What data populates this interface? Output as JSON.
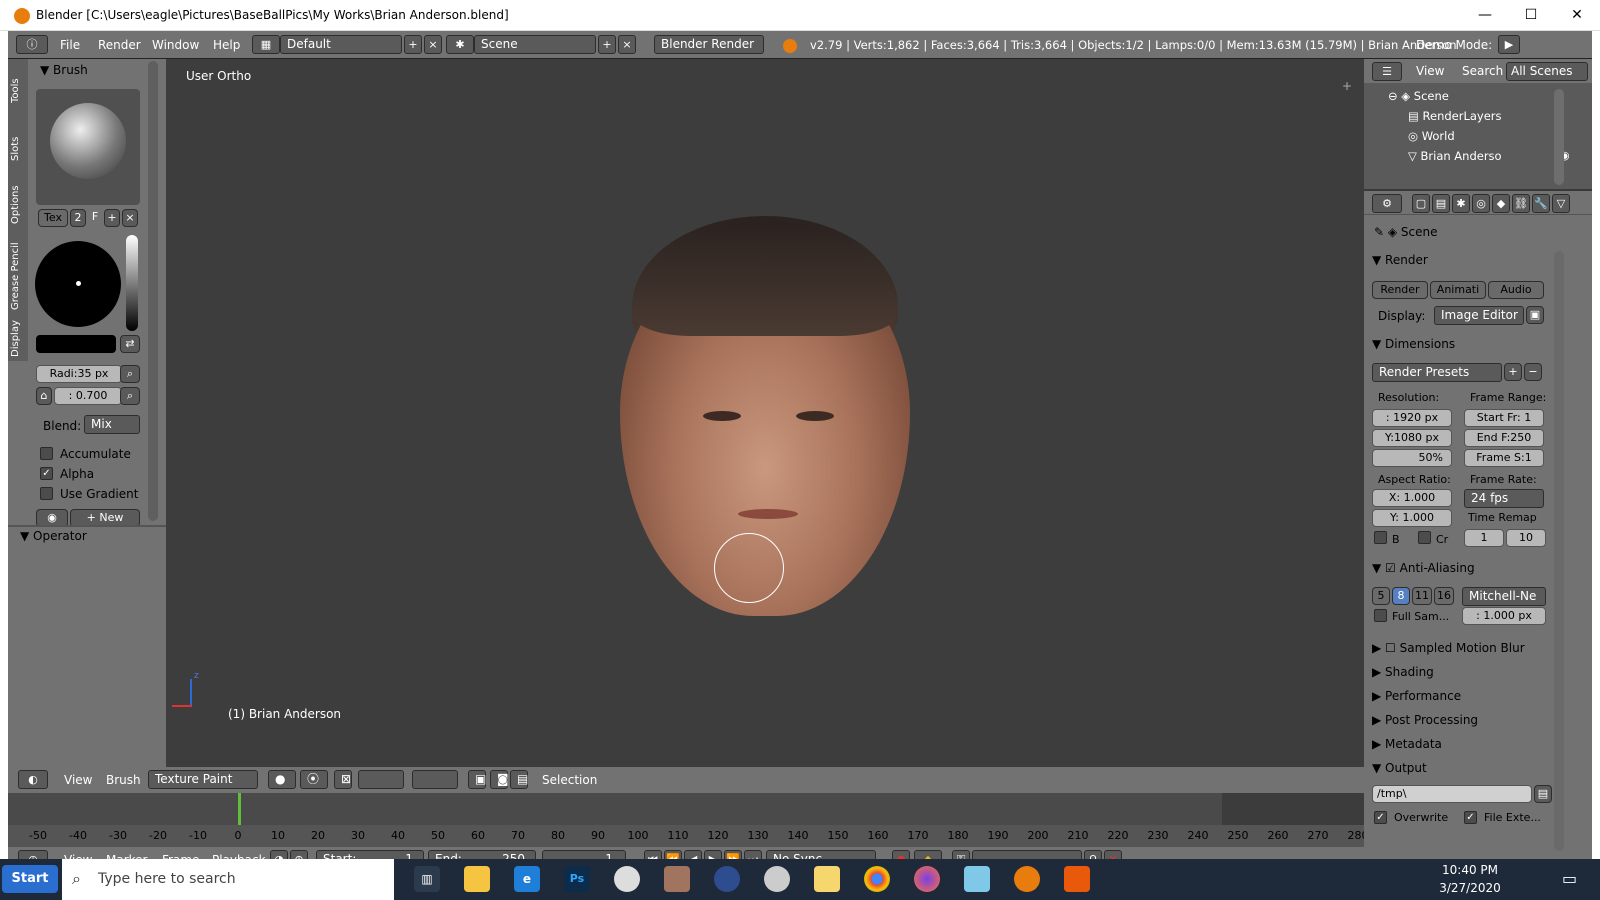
{
  "window": {
    "title": "Blender [C:\\Users\\eagle\\Pictures\\BaseBallPics\\My Works\\Brian Anderson.blend]",
    "minimize": "—",
    "maximize": "☐",
    "close": "✕"
  },
  "info_header": {
    "menus": [
      "File",
      "Render",
      "Window",
      "Help"
    ],
    "screen_layout": "Default",
    "scene": "Scene",
    "render_engine": "Blender Render",
    "stats": "v2.79 | Verts:1,862 | Faces:3,664 | Tris:3,664 | Objects:1/2 | Lamps:0/0 | Mem:13.63M (15.79M) | Brian Anderson",
    "demo_mode": "Demo Mode:"
  },
  "tool_tabs": [
    "Tools",
    "Slots",
    "Options",
    "Grease Pencil",
    "Display"
  ],
  "brush_panel": {
    "title": "Brush",
    "tex_label": "Tex",
    "tex_users": "2",
    "fake_user": "F",
    "radius": "Radi:35 px",
    "strength": ": 0.700",
    "blend_label": "Blend:",
    "blend_value": "Mix",
    "accumulate": "Accumulate",
    "alpha": "Alpha",
    "use_gradient": "Use Gradient",
    "new_label": "New"
  },
  "operator_panel": {
    "title": "Operator"
  },
  "viewport": {
    "view_name": "User Ortho",
    "object_label": "(1) Brian Anderson",
    "axis_z": "z"
  },
  "viewport_header": {
    "menus": [
      "View",
      "Brush"
    ],
    "mode": "Texture Paint",
    "selection": "Selection"
  },
  "timeline": {
    "ticks": [
      "-50",
      "-40",
      "-30",
      "-20",
      "-10",
      "0",
      "10",
      "20",
      "30",
      "40",
      "50",
      "60",
      "70",
      "80",
      "90",
      "100",
      "110",
      "120",
      "130",
      "140",
      "150",
      "160",
      "170",
      "180",
      "190",
      "200",
      "210",
      "220",
      "230",
      "240",
      "250",
      "260",
      "270",
      "280"
    ],
    "menus": [
      "View",
      "Marker",
      "Frame",
      "Playback"
    ],
    "start": "Start:",
    "start_value": "1",
    "end": "End:",
    "end_value": "250",
    "current": "1",
    "sync": "No Sync"
  },
  "outliner": {
    "menus": [
      "View",
      "Search"
    ],
    "filter": "All Scenes",
    "items": [
      "Scene",
      "RenderLayers",
      "World",
      "Brian Anderso"
    ]
  },
  "properties": {
    "context": "Scene",
    "render_section": "Render",
    "render_btn": "Render",
    "anim_btn": "Animati",
    "audio_btn": "Audio",
    "display_label": "Display:",
    "display_value": "Image Editor",
    "dimensions": "Dimensions",
    "render_presets": "Render Presets",
    "resolution": "Resolution:",
    "res_x": ": 1920 px",
    "res_y": "Y:1080 px",
    "res_pct": "50%",
    "frame_range": "Frame Range:",
    "start_fr": "Start Fr: 1",
    "end_f": "End F:250",
    "frame_s": "Frame S:1",
    "aspect_ratio": "Aspect Ratio:",
    "asp_x": "X:  1.000",
    "asp_y": "Y:  1.000",
    "frame_rate": "Frame Rate:",
    "fps": "24 fps",
    "time_remap": "Time Remap",
    "b_label": "B",
    "cr_label": "Cr",
    "remap_old": "1",
    "remap_new": "10",
    "anti_aliasing": "Anti-Aliasing",
    "aa_samples": [
      "5",
      "8",
      "11",
      "16"
    ],
    "aa_filter": "Mitchell-Ne",
    "full_sample": "Full Sam...",
    "filter_size": ": 1.000 px",
    "sampled_motion_blur": "Sampled Motion Blur",
    "shading": "Shading",
    "performance": "Performance",
    "post_processing": "Post Processing",
    "metadata": "Metadata",
    "output": "Output",
    "output_path": "/tmp\\",
    "overwrite": "Overwrite",
    "file_ext": "File Exte..."
  },
  "taskbar": {
    "start": "Start",
    "search": "Type here to search",
    "time": "10:40 PM",
    "date": "3/27/2020"
  }
}
